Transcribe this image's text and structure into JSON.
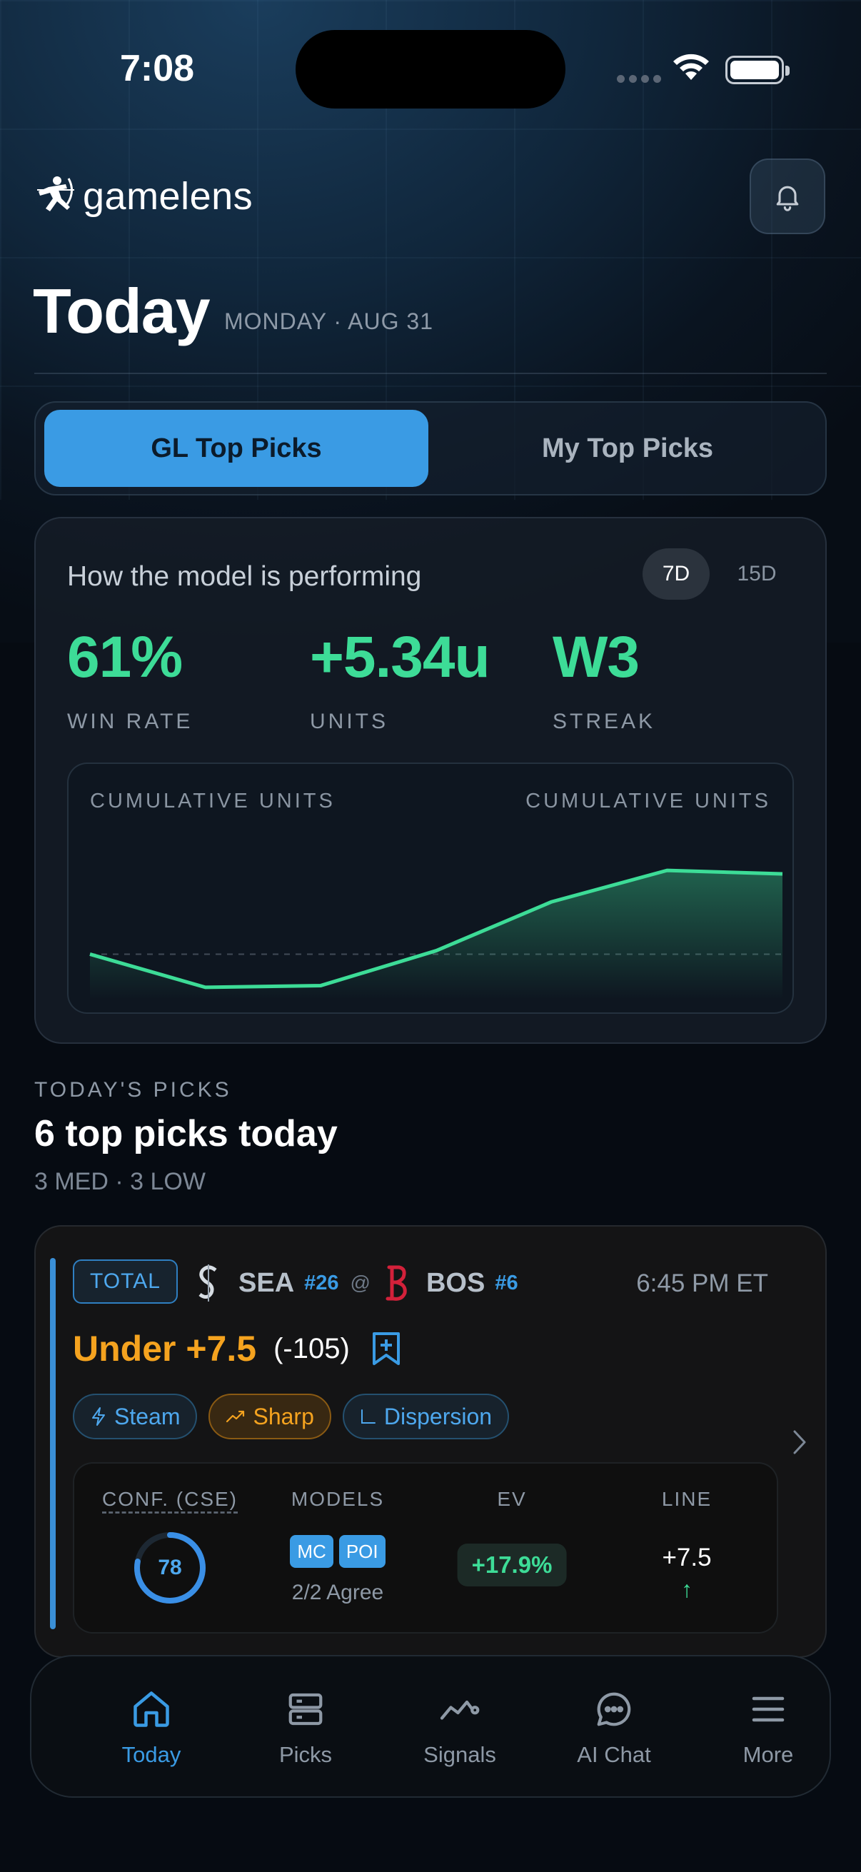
{
  "status_bar": {
    "time": "7:08"
  },
  "header": {
    "brand": "gamelens"
  },
  "page": {
    "title": "Today",
    "date": "MONDAY · AUG 31"
  },
  "segment": {
    "active": "GL Top Picks",
    "inactive": "My Top Picks"
  },
  "performance": {
    "title": "How the model is performing",
    "ranges": [
      "7D",
      "15D"
    ],
    "selected_range": "7D",
    "stats": [
      {
        "value": "61%",
        "label": "WIN RATE"
      },
      {
        "value": "+5.34u",
        "label": "UNITS"
      },
      {
        "value": "W3",
        "label": "STREAK"
      }
    ],
    "chart_label_left": "CUMULATIVE UNITS",
    "chart_label_right": "CUMULATIVE UNITS",
    "accent_color": "#3ddc97"
  },
  "chart_data": {
    "type": "area",
    "title": "CUMULATIVE UNITS",
    "x": [
      1,
      2,
      3,
      4,
      5,
      6,
      7
    ],
    "values": [
      0.0,
      -0.95,
      -0.9,
      0.1,
      1.5,
      2.4,
      2.3
    ],
    "baseline": 0,
    "ylim": [
      -1.3,
      3.2
    ],
    "grid": false
  },
  "picks_section": {
    "eyebrow": "TODAY'S PICKS",
    "title": "6 top picks today",
    "subtitle": "3 MED · 3 LOW"
  },
  "pick": {
    "market": "TOTAL",
    "away_team": "SEA",
    "away_rank": "#26",
    "at": "@",
    "home_team": "BOS",
    "home_rank": "#6",
    "time": "6:45 PM ET",
    "selection": "Under +7.5",
    "odds": "(-105)",
    "tags": [
      "Steam",
      "Sharp",
      "Dispersion"
    ],
    "metrics": {
      "conf_header": "CONF. (CSE)",
      "conf_value": "78",
      "conf_fraction": 0.78,
      "models_header": "MODELS",
      "models": [
        "MC",
        "POI"
      ],
      "models_agree": "2/2 Agree",
      "ev_header": "EV",
      "ev_value": "+17.9%",
      "line_header": "LINE",
      "line_value": "+7.5",
      "line_arrow": "↑"
    }
  },
  "tabbar": {
    "items": [
      {
        "label": "Today",
        "icon": "home-icon",
        "active": true
      },
      {
        "label": "Picks",
        "icon": "stack-icon",
        "active": false
      },
      {
        "label": "Signals",
        "icon": "signals-icon",
        "active": false
      },
      {
        "label": "AI Chat",
        "icon": "chat-icon",
        "active": false
      },
      {
        "label": "More",
        "icon": "menu-icon",
        "active": false
      }
    ]
  }
}
